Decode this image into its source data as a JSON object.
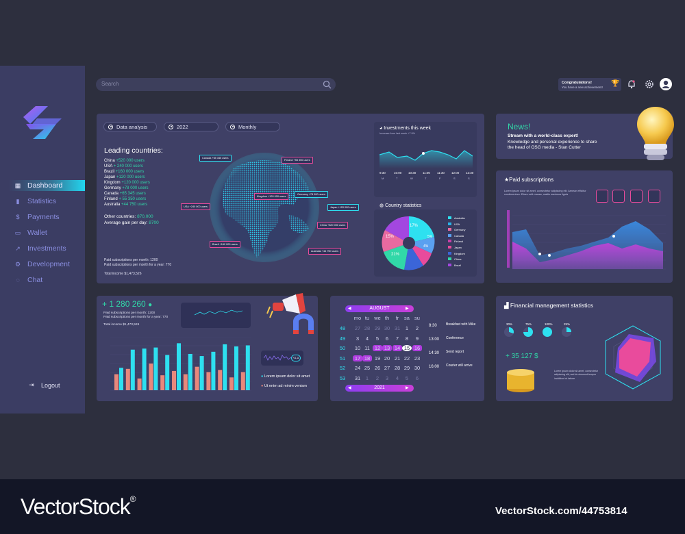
{
  "search": {
    "placeholder": "Search"
  },
  "notification": {
    "title": "Congratulations!",
    "text": "You have a new achievement!"
  },
  "sidebar": {
    "items": [
      {
        "label": "Dashboard",
        "icon": "grid-icon"
      },
      {
        "label": "Statistics",
        "icon": "bar-chart-icon"
      },
      {
        "label": "Payments",
        "icon": "dollar-icon"
      },
      {
        "label": "Wallet",
        "icon": "wallet-icon"
      },
      {
        "label": "Investments",
        "icon": "trend-icon"
      },
      {
        "label": "Development",
        "icon": "gear-icon"
      },
      {
        "label": "Chat",
        "icon": "chat-icon"
      }
    ],
    "logout": "Logout"
  },
  "map_panel": {
    "filters": [
      "Data analysis",
      "2022",
      "Monthly"
    ],
    "title": "Leading countries:",
    "countries": [
      {
        "name": "China",
        "value": "+520 000 users"
      },
      {
        "name": "USA",
        "value": "+ 240 000 users"
      },
      {
        "name": "Brazil",
        "value": "+160 000 users"
      },
      {
        "name": "Japan",
        "value": "+120 000 users"
      },
      {
        "name": "Kingdom",
        "value": "+120 000 users"
      },
      {
        "name": "Germany",
        "value": "+78 000 users"
      },
      {
        "name": "Canada",
        "value": "+65 345 users"
      },
      {
        "name": "Finland",
        "value": "+ 55 350 users"
      },
      {
        "name": "Australia",
        "value": "+44 750 users"
      }
    ],
    "other_countries_label": "Other countries:",
    "other_countries_value": "870,000",
    "avg_gain_label": "Average gain per day:",
    "avg_gain_value": "8700",
    "paid_month": "Paid subscriptions per month: 1200",
    "paid_year": "Paid subscriptions per month for a year: 770",
    "total_income": "Total income $1,473,526",
    "globe_labels": [
      "Canada +65 345 users",
      "Finland +55 350 users",
      "USA +240 000 users",
      "Kingdom +120 000 users",
      "Germany +78 000 users",
      "Japan +120 000 users",
      "China +520 000 users",
      "Brazil +160 000 users",
      "Australia +44 750 users"
    ]
  },
  "investments": {
    "title": "Investments this week",
    "subtitle": "Increase from last week +7.9%",
    "times": [
      "9:30",
      "10:00",
      "10:30",
      "11:00",
      "11:30",
      "12:00",
      "12:30"
    ],
    "days": [
      "M",
      "T",
      "W",
      "T",
      "F",
      "S",
      "S"
    ]
  },
  "country_stats": {
    "title": "Country statistics",
    "labels": [
      "17%",
      "15%",
      "21%",
      "5%",
      "4%"
    ],
    "legend": [
      {
        "name": "Australia",
        "color": "#2ee0f0"
      },
      {
        "name": "USA",
        "color": "#29b3e8"
      },
      {
        "name": "Germany",
        "color": "#e86aa0"
      },
      {
        "name": "Canada",
        "color": "#5aa0f0"
      },
      {
        "name": "Finland",
        "color": "#c93fa8"
      },
      {
        "name": "Japan",
        "color": "#e94b9c"
      },
      {
        "name": "Kingdom",
        "color": "#3b65d8"
      },
      {
        "name": "China",
        "color": "#31d8a8"
      },
      {
        "name": "Brazil",
        "color": "#a347e0"
      }
    ]
  },
  "news": {
    "title": "News!",
    "headline": "Stream with a world-class expert!",
    "body": "Knowledge and personal experience to share the head of OSG media - Stan Cutter"
  },
  "paid_subs": {
    "title": "Paid subscriptions",
    "desc": "Lorem ipsum dolor sit amet, consectetur adipiscing elit. Aenean efficitur condimentum. Etiam velit massa, mattis maximus ligula"
  },
  "users_panel": {
    "count": "+ 1 280 260",
    "line1": "Paid subscriptions per month: 1200",
    "line2": "Paid subscriptions per month for a year: 770",
    "line3": "Total income $1,473,526",
    "legend1": "Lorem ipsum dolor sit amet",
    "legend2": "Ut enim ad minim veniam",
    "mini_value": "+11,11"
  },
  "calendar": {
    "month": "AUGUST",
    "year": "2021",
    "weekdays": [
      "mo",
      "tu",
      "we",
      "th",
      "fr",
      "sa",
      "su"
    ],
    "weeks": [
      {
        "wk": "48",
        "days": [
          "27",
          "28",
          "29",
          "30",
          "31",
          "1",
          "2"
        ]
      },
      {
        "wk": "49",
        "days": [
          "3",
          "4",
          "5",
          "6",
          "7",
          "8",
          "9"
        ]
      },
      {
        "wk": "50",
        "days": [
          "10",
          "11",
          "12",
          "13",
          "14",
          "15",
          "16"
        ]
      },
      {
        "wk": "51",
        "days": [
          "17",
          "18",
          "19",
          "20",
          "21",
          "22",
          "23"
        ]
      },
      {
        "wk": "52",
        "days": [
          "24",
          "25",
          "26",
          "27",
          "28",
          "29",
          "30"
        ]
      },
      {
        "wk": "53",
        "days": [
          "31",
          "1",
          "2",
          "3",
          "4",
          "5",
          "6"
        ]
      }
    ],
    "events": [
      {
        "time": "8:30",
        "title": "Breakfast with Mike"
      },
      {
        "time": "13:00",
        "title": "Conference"
      },
      {
        "time": "14:30",
        "title": "Send report"
      },
      {
        "time": "16:00",
        "title": "Courier will arrive"
      }
    ]
  },
  "finance": {
    "title": "Financial management statistics",
    "amount": "+ 35 127 $",
    "percents": [
      "30%",
      "75%",
      "100%",
      "25%"
    ],
    "desc": "Lorem ipsum dolor sit amet, consectetur adipiscing elit, sed do eiusmod tempor incididunt ut labore"
  },
  "watermark": {
    "brand": "VectorStock",
    "reg": "®",
    "url": "VectorStock.com/44753814"
  },
  "colors": {
    "accent": "#2ee0f0",
    "magenta": "#c93fd8",
    "green": "#31d8a8",
    "panel": "#3f4066",
    "bg": "#2d2f3e"
  },
  "chart_data": [
    {
      "type": "bar",
      "title": "",
      "series": [
        {
          "color": "#2ee0f0",
          "values": [
            42,
            76,
            78,
            80,
            66,
            88,
            68,
            64,
            72,
            86,
            82,
            84
          ]
        },
        {
          "color": "#e8887c",
          "values": [
            30,
            40,
            22,
            50,
            28,
            36,
            30,
            44,
            34,
            38,
            24,
            34
          ]
        }
      ]
    },
    {
      "type": "area",
      "title": "Paid subscriptions",
      "series": [
        {
          "color": "#3a8fe8",
          "values": [
            54,
            58,
            20,
            24,
            30,
            34,
            40,
            46,
            62,
            70,
            58,
            38
          ]
        },
        {
          "color": "#c93fd8",
          "values": [
            40,
            30,
            10,
            14,
            20,
            26,
            34,
            38,
            30,
            36,
            30,
            26
          ]
        }
      ]
    }
  ]
}
